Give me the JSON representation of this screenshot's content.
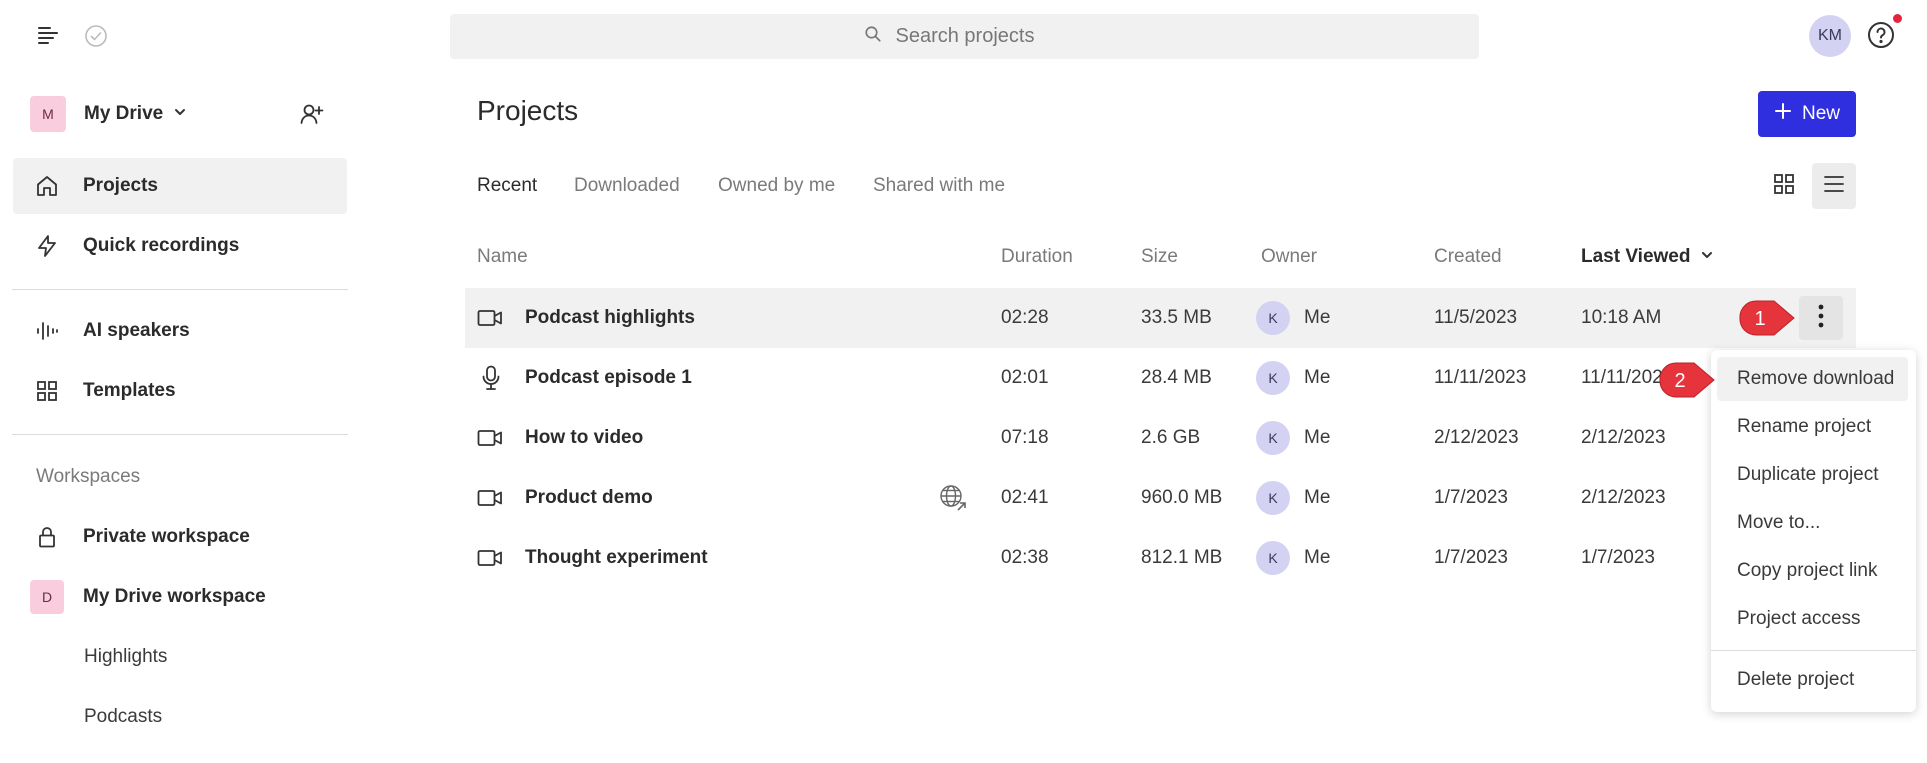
{
  "topbar": {
    "search_placeholder": "Search projects",
    "user_initials": "KM"
  },
  "sidebar": {
    "drive": {
      "initial": "M",
      "name": "My Drive"
    },
    "nav": [
      {
        "label": "Projects",
        "icon": "home-icon",
        "active": true
      },
      {
        "label": "Quick recordings",
        "icon": "lightning-icon"
      },
      {
        "label": "AI speakers",
        "icon": "waveform-icon"
      },
      {
        "label": "Templates",
        "icon": "grid-icon"
      }
    ],
    "workspaces_label": "Workspaces",
    "workspaces": [
      {
        "label": "Private workspace",
        "icon": "lock-icon"
      },
      {
        "label": "My Drive workspace",
        "initial": "D"
      }
    ],
    "sub_items": [
      "Highlights",
      "Podcasts"
    ]
  },
  "main": {
    "title": "Projects",
    "new_button": "New",
    "tabs": [
      "Recent",
      "Downloaded",
      "Owned by me",
      "Shared with me"
    ],
    "columns": [
      "Name",
      "Duration",
      "Size",
      "Owner",
      "Created",
      "Last Viewed"
    ],
    "rows": [
      {
        "icon": "video-icon",
        "name": "Podcast highlights",
        "duration": "02:28",
        "size": "33.5 MB",
        "owner_initial": "K",
        "owner": "Me",
        "created": "11/5/2023",
        "last_viewed": "10:18 AM"
      },
      {
        "icon": "microphone-icon",
        "name": "Podcast episode 1",
        "duration": "02:01",
        "size": "28.4 MB",
        "owner_initial": "K",
        "owner": "Me",
        "created": "11/11/2023",
        "last_viewed": "11/11/202"
      },
      {
        "icon": "video-icon",
        "name": "How to video",
        "duration": "07:18",
        "size": "2.6 GB",
        "owner_initial": "K",
        "owner": "Me",
        "created": "2/12/2023",
        "last_viewed": "2/12/2023"
      },
      {
        "icon": "video-icon",
        "name": "Product demo",
        "duration": "02:41",
        "size": "960.0 MB",
        "owner_initial": "K",
        "owner": "Me",
        "created": "1/7/2023",
        "last_viewed": "2/12/2023"
      },
      {
        "icon": "video-icon",
        "name": "Thought experiment",
        "duration": "02:38",
        "size": "812.1 MB",
        "owner_initial": "K",
        "owner": "Me",
        "created": "1/7/2023",
        "last_viewed": "1/7/2023"
      }
    ]
  },
  "context_menu": {
    "items": [
      "Remove download",
      "Rename project",
      "Duplicate project",
      "Move to...",
      "Copy project link",
      "Project access"
    ],
    "danger_item": "Delete project"
  },
  "callouts": [
    "1",
    "2"
  ],
  "colors": {
    "accent": "#2f2fe0",
    "callout": "#e5343b",
    "avatar": "#d4d2f3",
    "drive_badge": "#f9cddd"
  }
}
